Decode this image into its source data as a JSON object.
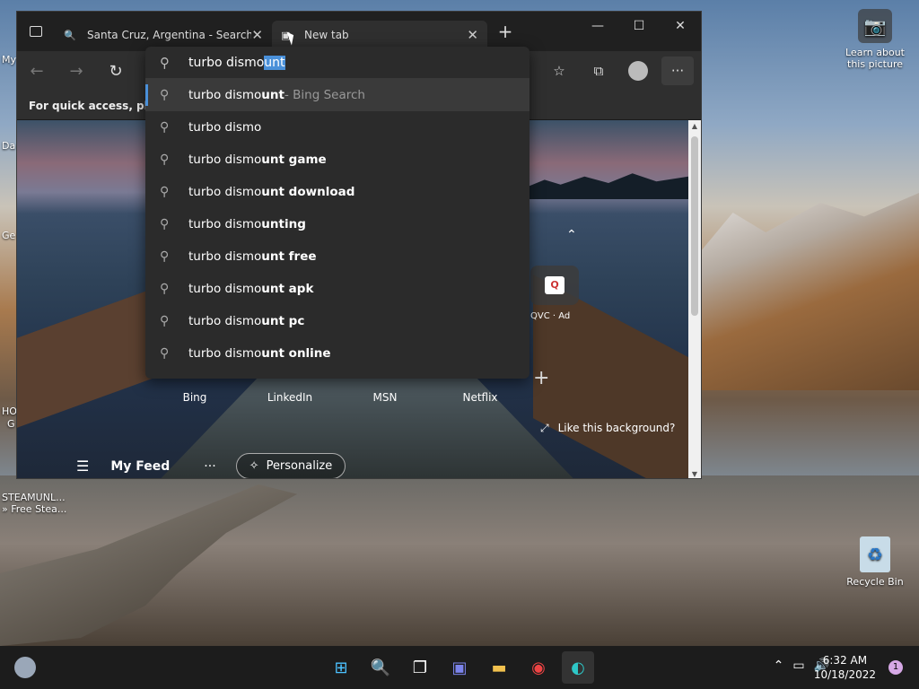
{
  "browser": {
    "tabs": [
      {
        "title": "Santa Cruz, Argentina - Search",
        "icon": "search-icon",
        "close": "✕"
      },
      {
        "title": "New tab",
        "icon": "newtab-page-icon",
        "close": "✕"
      }
    ],
    "new_tab_symbol": "+",
    "favorites_bar_text": "For quick access, place y",
    "omnibox": {
      "typed": "turbo dismo",
      "autocomplete_selected": "unt",
      "suggestions": [
        {
          "plain": "turbo dismo",
          "bold": "unt",
          "source": " - Bing Search"
        },
        {
          "plain": "turbo dismo",
          "bold": "",
          "source": ""
        },
        {
          "plain": "turbo dismo",
          "bold": "unt game",
          "source": ""
        },
        {
          "plain": "turbo dismo",
          "bold": "unt download",
          "source": ""
        },
        {
          "plain": "turbo dismo",
          "bold": "unting",
          "source": ""
        },
        {
          "plain": "turbo dismo",
          "bold": "unt free",
          "source": ""
        },
        {
          "plain": "turbo dismo",
          "bold": "unt apk",
          "source": ""
        },
        {
          "plain": "turbo dismo",
          "bold": "unt pc",
          "source": ""
        },
        {
          "plain": "turbo dismo",
          "bold": "unt online",
          "source": ""
        }
      ]
    },
    "ntp": {
      "quick_links": [
        "Bing",
        "LinkedIn",
        "MSN",
        "Netflix"
      ],
      "qvc_label": "QVC · Ad",
      "like_background": "Like this background?",
      "my_feed": "My Feed",
      "feed_more": "···",
      "personalize": "Personalize"
    }
  },
  "desktop": {
    "learn_picture": "Learn about this picture",
    "recycle_bin": "Recycle Bin",
    "steam_label_1": "STEAMUNL...",
    "steam_label_2": "» Free Stea...",
    "edge_labels": [
      "My",
      "Da",
      "Ge",
      "HO",
      "G"
    ]
  },
  "taskbar": {
    "time": "6:32 AM",
    "date": "10/18/2022",
    "notification_count": "1"
  }
}
